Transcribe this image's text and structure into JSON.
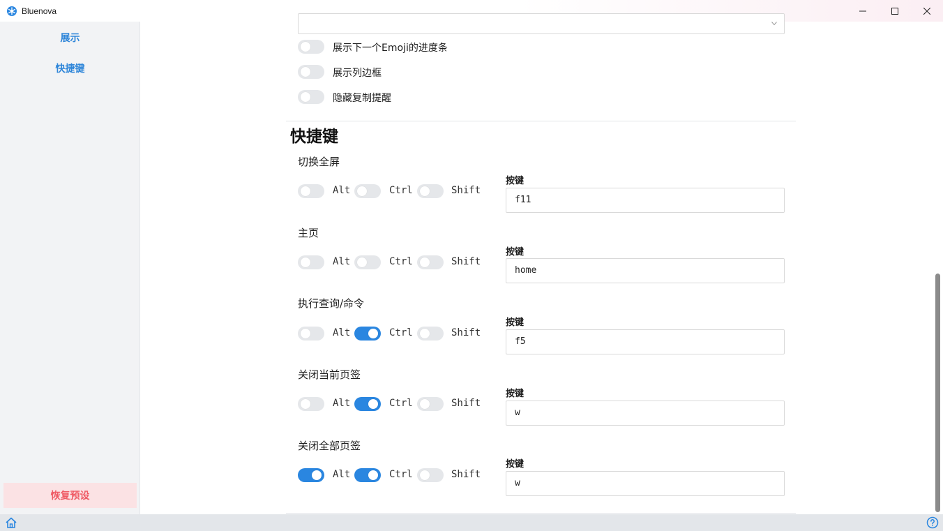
{
  "window": {
    "title": "Bluenova",
    "controls": [
      "minimize",
      "maximize",
      "close"
    ]
  },
  "sidebar": {
    "items": [
      {
        "label": "展示"
      },
      {
        "label": "快捷键"
      }
    ],
    "reset_label": "恢复预设"
  },
  "display_options": [
    {
      "label": "展示下一个Emoji的进度条",
      "enabled": false
    },
    {
      "label": "展示列边框",
      "enabled": false
    },
    {
      "label": "隐藏复制提醒",
      "enabled": false
    }
  ],
  "shortcuts_section": {
    "title": "快捷键",
    "modifier_labels": {
      "alt": "Alt",
      "ctrl": "Ctrl",
      "shift": "Shift"
    },
    "key_label": "按键",
    "items": [
      {
        "name": "切换全屏",
        "alt": false,
        "ctrl": false,
        "shift": false,
        "key": "f11"
      },
      {
        "name": "主页",
        "alt": false,
        "ctrl": false,
        "shift": false,
        "key": "home"
      },
      {
        "name": "执行查询/命令",
        "alt": false,
        "ctrl": true,
        "shift": false,
        "key": "f5"
      },
      {
        "name": "关闭当前页签",
        "alt": false,
        "ctrl": true,
        "shift": false,
        "key": "w"
      },
      {
        "name": "关闭全部页签",
        "alt": true,
        "ctrl": true,
        "shift": false,
        "key": "w"
      }
    ]
  },
  "statusbar": {
    "icons": [
      "home-icon",
      "help-icon"
    ]
  },
  "colors": {
    "accent": "#2a86e0",
    "sidebar_link": "#2f86d9",
    "reset_text": "#ef5b65",
    "reset_bg": "#fbe2e4"
  }
}
